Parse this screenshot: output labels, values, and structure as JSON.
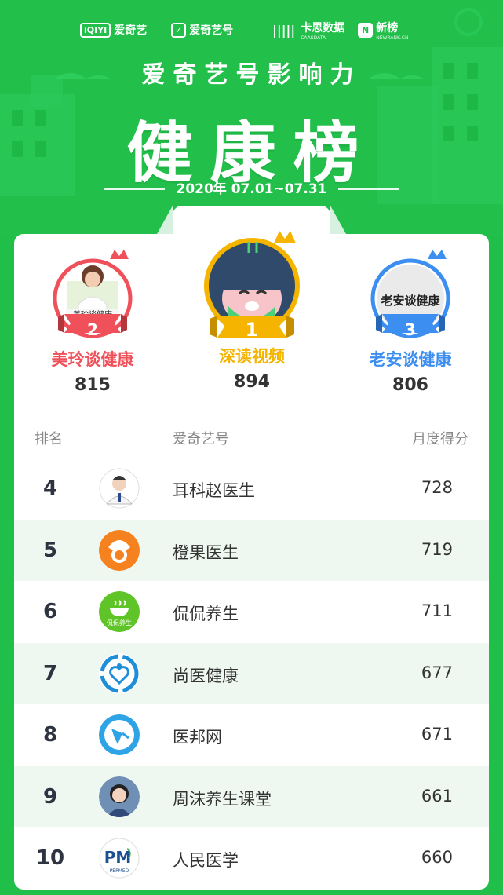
{
  "header": {
    "logos": [
      {
        "mark": "iQIYI",
        "label": "爱奇艺"
      },
      {
        "mark": "✓",
        "label": "爱奇艺号"
      },
      {
        "mark": "|||||",
        "label": "卡思数据",
        "sub": "CAASDATA"
      },
      {
        "mark": "N",
        "label": "新榜",
        "sub": "NEWRANK.CN"
      }
    ],
    "subtitle": "爱奇艺号影响力",
    "title": "健康榜",
    "date": "2020年 07.01~07.31"
  },
  "podium": [
    {
      "rank": "2",
      "name": "美玲谈健康",
      "score": "815",
      "color": "#f0505a",
      "avatar_caption": "美玲谈健康"
    },
    {
      "rank": "1",
      "name": "深读视频",
      "score": "894",
      "color": "#f4b400"
    },
    {
      "rank": "3",
      "name": "老安谈健康",
      "score": "806",
      "color": "#3c8ff0",
      "avatar_caption": "老安谈健康"
    }
  ],
  "table": {
    "headers": {
      "rank": "排名",
      "account": "爱奇艺号",
      "score": "月度得分"
    },
    "rows": [
      {
        "rank": "4",
        "name": "耳科赵医生",
        "score": "728",
        "icon": "doctor-avatar"
      },
      {
        "rank": "5",
        "name": "橙果医生",
        "score": "719",
        "icon": "orange-logo"
      },
      {
        "rank": "6",
        "name": "侃侃养生",
        "score": "711",
        "icon": "bowl-logo",
        "icon_text": "侃侃养生"
      },
      {
        "rank": "7",
        "name": "尚医健康",
        "score": "677",
        "icon": "heart-logo"
      },
      {
        "rank": "8",
        "name": "医邦网",
        "score": "671",
        "icon": "bird-logo"
      },
      {
        "rank": "9",
        "name": "周沫养生课堂",
        "score": "661",
        "icon": "woman-avatar"
      },
      {
        "rank": "10",
        "name": "人民医学",
        "score": "660",
        "icon": "pepmed-logo",
        "icon_text": "PEPMED"
      }
    ]
  }
}
